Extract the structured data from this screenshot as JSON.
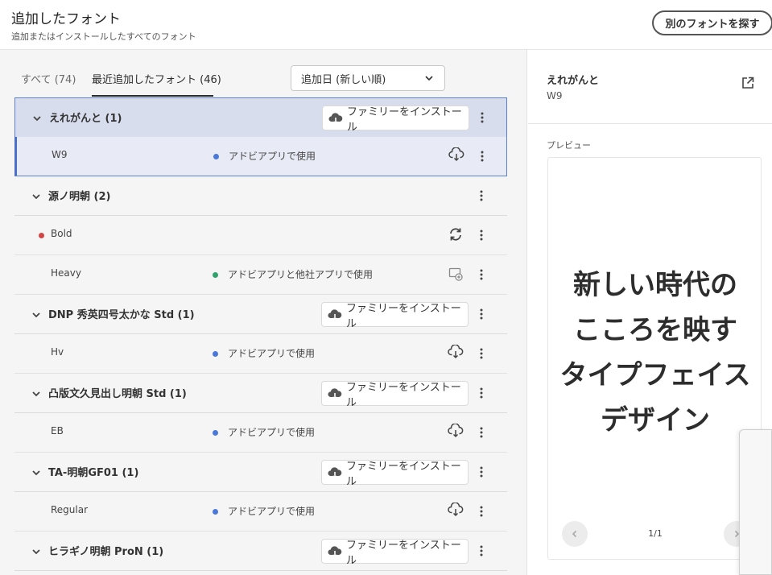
{
  "header": {
    "title": "追加したフォント",
    "subtitle": "追加またはインストールしたすべてのフォント",
    "browse_label": "別のフォントを探す"
  },
  "tabs": {
    "all": "すべて (74)",
    "recent": "最近追加したフォント (46)"
  },
  "sort": {
    "selected": "追加日 (新しい順)"
  },
  "install_label": "ファミリーをインストール",
  "families": [
    {
      "name": "えれがんと (1)",
      "install": true,
      "selected": true,
      "styles": [
        {
          "name": "W9",
          "status": "アドビアプリで使用",
          "status_color": "#4a78d8",
          "icon": "cloud-download-icon"
        }
      ]
    },
    {
      "name": "源ノ明朝 (2)",
      "install": false,
      "styles": [
        {
          "name": "Bold",
          "status": "",
          "status_color": "",
          "dot": "#d14545",
          "icon": "sync-icon"
        },
        {
          "name": "Heavy",
          "status": "アドビアプリと他社アプリで使用",
          "status_color": "#2fa36b",
          "icon": "installed-icon"
        }
      ]
    },
    {
      "name": "DNP 秀英四号太かな Std (1)",
      "install": true,
      "styles": [
        {
          "name": "Hv",
          "status": "アドビアプリで使用",
          "status_color": "#4a78d8",
          "icon": "cloud-download-icon"
        }
      ]
    },
    {
      "name": "凸版文久見出し明朝 Std (1)",
      "install": true,
      "styles": [
        {
          "name": "EB",
          "status": "アドビアプリで使用",
          "status_color": "#4a78d8",
          "icon": "cloud-download-icon"
        }
      ]
    },
    {
      "name": "TA-明朝GF01 (1)",
      "install": true,
      "styles": [
        {
          "name": "Regular",
          "status": "アドビアプリで使用",
          "status_color": "#4a78d8",
          "icon": "cloud-download-icon"
        }
      ]
    },
    {
      "name": "ヒラギノ明朝 ProN (1)",
      "install": true,
      "styles": []
    }
  ],
  "detail": {
    "family": "えれがんと",
    "style": "W9",
    "preview_label": "プレビュー",
    "preview_lines": [
      "新しい時代の",
      "こころを映す",
      "タイプフェイス",
      "デザイン"
    ],
    "page": "1/1"
  }
}
